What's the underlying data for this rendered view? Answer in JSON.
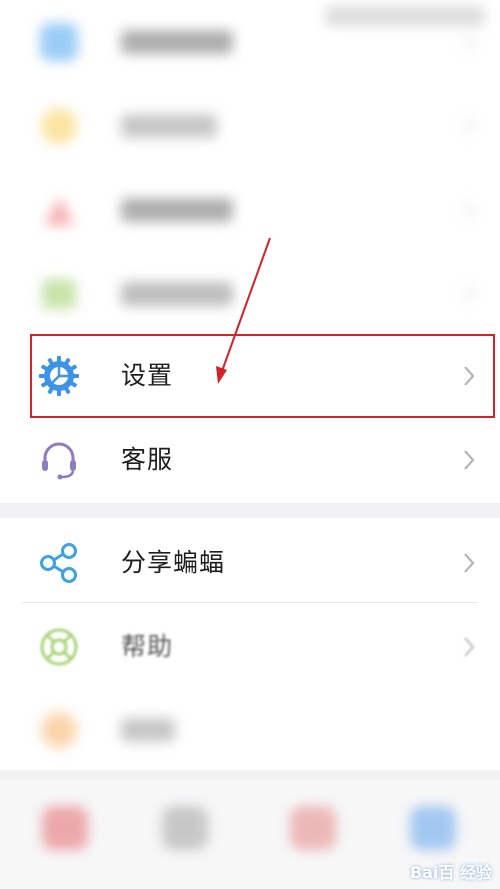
{
  "menu": {
    "blurred_items": [
      {
        "icon": "blurred-blue-icon",
        "color": "#4aa3ef"
      },
      {
        "icon": "blurred-yellow-icon",
        "color": "#f6cf55"
      },
      {
        "icon": "blurred-red-icon",
        "color": "#ef6c6c"
      },
      {
        "icon": "blurred-green-icon",
        "color": "#9ccc65"
      }
    ],
    "settings": {
      "label": "设置",
      "icon": "gear-icon",
      "color": "#3d94e6"
    },
    "customer_service": {
      "label": "客服",
      "icon": "headset-icon",
      "color": "#8e7cc3"
    },
    "share": {
      "label": "分享蝙蝠",
      "icon": "share-icon",
      "color": "#3da2e0"
    },
    "help": {
      "label": "帮助",
      "icon": "help-icon",
      "color": "#8bc34a"
    },
    "blurred_bottom": {
      "icon": "blurred-orange-icon",
      "color": "#f7b267"
    }
  },
  "annotation": {
    "highlight_color": "#d3232a"
  },
  "watermark": {
    "text": "Bai百 经验"
  }
}
